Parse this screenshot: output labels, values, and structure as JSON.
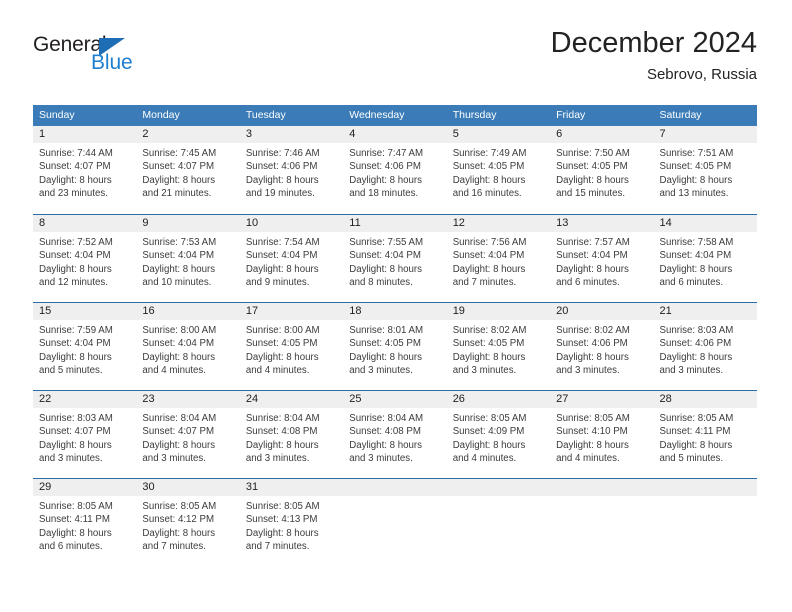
{
  "brand": {
    "name_top": "General",
    "name_bottom": "Blue",
    "triangle_color": "#1f6eb5",
    "blue_color": "#1f7fd0"
  },
  "header": {
    "month_title": "December 2024",
    "location": "Sebrovo, Russia"
  },
  "theme": {
    "header_band": "#3b7cb8",
    "row_divider": "#2e6da4",
    "day_number_band": "#efefef",
    "text": "#3c3c3c"
  },
  "calendar": {
    "weekdays": [
      "Sunday",
      "Monday",
      "Tuesday",
      "Wednesday",
      "Thursday",
      "Friday",
      "Saturday"
    ],
    "weeks": [
      [
        {
          "day": "1",
          "sunrise": "Sunrise: 7:44 AM",
          "sunset": "Sunset: 4:07 PM",
          "daylight_1": "Daylight: 8 hours",
          "daylight_2": "and 23 minutes."
        },
        {
          "day": "2",
          "sunrise": "Sunrise: 7:45 AM",
          "sunset": "Sunset: 4:07 PM",
          "daylight_1": "Daylight: 8 hours",
          "daylight_2": "and 21 minutes."
        },
        {
          "day": "3",
          "sunrise": "Sunrise: 7:46 AM",
          "sunset": "Sunset: 4:06 PM",
          "daylight_1": "Daylight: 8 hours",
          "daylight_2": "and 19 minutes."
        },
        {
          "day": "4",
          "sunrise": "Sunrise: 7:47 AM",
          "sunset": "Sunset: 4:06 PM",
          "daylight_1": "Daylight: 8 hours",
          "daylight_2": "and 18 minutes."
        },
        {
          "day": "5",
          "sunrise": "Sunrise: 7:49 AM",
          "sunset": "Sunset: 4:05 PM",
          "daylight_1": "Daylight: 8 hours",
          "daylight_2": "and 16 minutes."
        },
        {
          "day": "6",
          "sunrise": "Sunrise: 7:50 AM",
          "sunset": "Sunset: 4:05 PM",
          "daylight_1": "Daylight: 8 hours",
          "daylight_2": "and 15 minutes."
        },
        {
          "day": "7",
          "sunrise": "Sunrise: 7:51 AM",
          "sunset": "Sunset: 4:05 PM",
          "daylight_1": "Daylight: 8 hours",
          "daylight_2": "and 13 minutes."
        }
      ],
      [
        {
          "day": "8",
          "sunrise": "Sunrise: 7:52 AM",
          "sunset": "Sunset: 4:04 PM",
          "daylight_1": "Daylight: 8 hours",
          "daylight_2": "and 12 minutes."
        },
        {
          "day": "9",
          "sunrise": "Sunrise: 7:53 AM",
          "sunset": "Sunset: 4:04 PM",
          "daylight_1": "Daylight: 8 hours",
          "daylight_2": "and 10 minutes."
        },
        {
          "day": "10",
          "sunrise": "Sunrise: 7:54 AM",
          "sunset": "Sunset: 4:04 PM",
          "daylight_1": "Daylight: 8 hours",
          "daylight_2": "and 9 minutes."
        },
        {
          "day": "11",
          "sunrise": "Sunrise: 7:55 AM",
          "sunset": "Sunset: 4:04 PM",
          "daylight_1": "Daylight: 8 hours",
          "daylight_2": "and 8 minutes."
        },
        {
          "day": "12",
          "sunrise": "Sunrise: 7:56 AM",
          "sunset": "Sunset: 4:04 PM",
          "daylight_1": "Daylight: 8 hours",
          "daylight_2": "and 7 minutes."
        },
        {
          "day": "13",
          "sunrise": "Sunrise: 7:57 AM",
          "sunset": "Sunset: 4:04 PM",
          "daylight_1": "Daylight: 8 hours",
          "daylight_2": "and 6 minutes."
        },
        {
          "day": "14",
          "sunrise": "Sunrise: 7:58 AM",
          "sunset": "Sunset: 4:04 PM",
          "daylight_1": "Daylight: 8 hours",
          "daylight_2": "and 6 minutes."
        }
      ],
      [
        {
          "day": "15",
          "sunrise": "Sunrise: 7:59 AM",
          "sunset": "Sunset: 4:04 PM",
          "daylight_1": "Daylight: 8 hours",
          "daylight_2": "and 5 minutes."
        },
        {
          "day": "16",
          "sunrise": "Sunrise: 8:00 AM",
          "sunset": "Sunset: 4:04 PM",
          "daylight_1": "Daylight: 8 hours",
          "daylight_2": "and 4 minutes."
        },
        {
          "day": "17",
          "sunrise": "Sunrise: 8:00 AM",
          "sunset": "Sunset: 4:05 PM",
          "daylight_1": "Daylight: 8 hours",
          "daylight_2": "and 4 minutes."
        },
        {
          "day": "18",
          "sunrise": "Sunrise: 8:01 AM",
          "sunset": "Sunset: 4:05 PM",
          "daylight_1": "Daylight: 8 hours",
          "daylight_2": "and 3 minutes."
        },
        {
          "day": "19",
          "sunrise": "Sunrise: 8:02 AM",
          "sunset": "Sunset: 4:05 PM",
          "daylight_1": "Daylight: 8 hours",
          "daylight_2": "and 3 minutes."
        },
        {
          "day": "20",
          "sunrise": "Sunrise: 8:02 AM",
          "sunset": "Sunset: 4:06 PM",
          "daylight_1": "Daylight: 8 hours",
          "daylight_2": "and 3 minutes."
        },
        {
          "day": "21",
          "sunrise": "Sunrise: 8:03 AM",
          "sunset": "Sunset: 4:06 PM",
          "daylight_1": "Daylight: 8 hours",
          "daylight_2": "and 3 minutes."
        }
      ],
      [
        {
          "day": "22",
          "sunrise": "Sunrise: 8:03 AM",
          "sunset": "Sunset: 4:07 PM",
          "daylight_1": "Daylight: 8 hours",
          "daylight_2": "and 3 minutes."
        },
        {
          "day": "23",
          "sunrise": "Sunrise: 8:04 AM",
          "sunset": "Sunset: 4:07 PM",
          "daylight_1": "Daylight: 8 hours",
          "daylight_2": "and 3 minutes."
        },
        {
          "day": "24",
          "sunrise": "Sunrise: 8:04 AM",
          "sunset": "Sunset: 4:08 PM",
          "daylight_1": "Daylight: 8 hours",
          "daylight_2": "and 3 minutes."
        },
        {
          "day": "25",
          "sunrise": "Sunrise: 8:04 AM",
          "sunset": "Sunset: 4:08 PM",
          "daylight_1": "Daylight: 8 hours",
          "daylight_2": "and 3 minutes."
        },
        {
          "day": "26",
          "sunrise": "Sunrise: 8:05 AM",
          "sunset": "Sunset: 4:09 PM",
          "daylight_1": "Daylight: 8 hours",
          "daylight_2": "and 4 minutes."
        },
        {
          "day": "27",
          "sunrise": "Sunrise: 8:05 AM",
          "sunset": "Sunset: 4:10 PM",
          "daylight_1": "Daylight: 8 hours",
          "daylight_2": "and 4 minutes."
        },
        {
          "day": "28",
          "sunrise": "Sunrise: 8:05 AM",
          "sunset": "Sunset: 4:11 PM",
          "daylight_1": "Daylight: 8 hours",
          "daylight_2": "and 5 minutes."
        }
      ],
      [
        {
          "day": "29",
          "sunrise": "Sunrise: 8:05 AM",
          "sunset": "Sunset: 4:11 PM",
          "daylight_1": "Daylight: 8 hours",
          "daylight_2": "and 6 minutes."
        },
        {
          "day": "30",
          "sunrise": "Sunrise: 8:05 AM",
          "sunset": "Sunset: 4:12 PM",
          "daylight_1": "Daylight: 8 hours",
          "daylight_2": "and 7 minutes."
        },
        {
          "day": "31",
          "sunrise": "Sunrise: 8:05 AM",
          "sunset": "Sunset: 4:13 PM",
          "daylight_1": "Daylight: 8 hours",
          "daylight_2": "and 7 minutes."
        },
        {
          "day": "",
          "sunrise": "",
          "sunset": "",
          "daylight_1": "",
          "daylight_2": ""
        },
        {
          "day": "",
          "sunrise": "",
          "sunset": "",
          "daylight_1": "",
          "daylight_2": ""
        },
        {
          "day": "",
          "sunrise": "",
          "sunset": "",
          "daylight_1": "",
          "daylight_2": ""
        },
        {
          "day": "",
          "sunrise": "",
          "sunset": "",
          "daylight_1": "",
          "daylight_2": ""
        }
      ]
    ]
  }
}
